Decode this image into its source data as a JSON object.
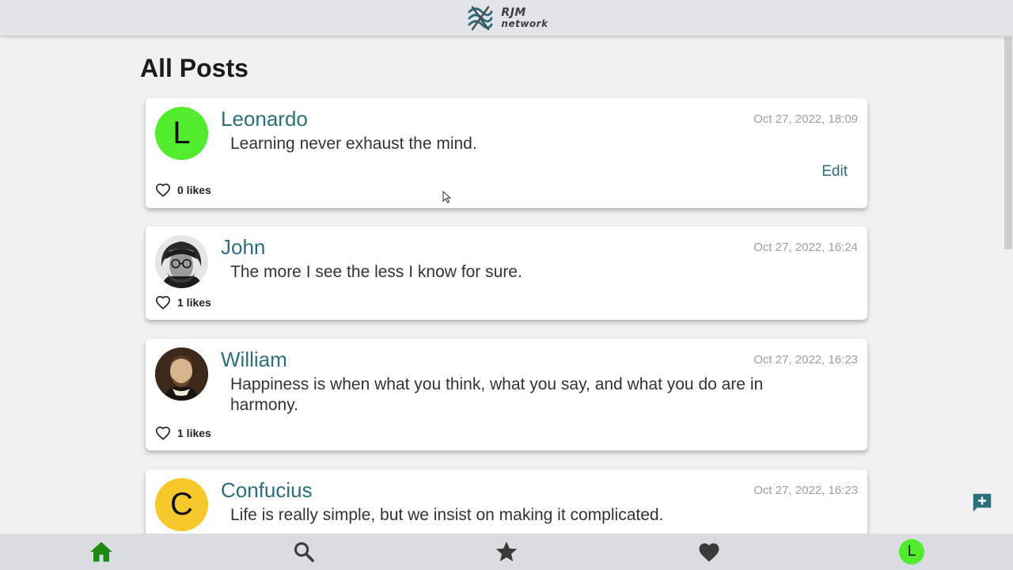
{
  "header": {
    "logo_line1": "RJM",
    "logo_line2": "network"
  },
  "page": {
    "title": "All Posts"
  },
  "posts": [
    {
      "author": "Leonardo",
      "avatar_initial": "L",
      "avatar_color": "#52ec2e",
      "timestamp": "Oct 27, 2022, 18:09",
      "content": "Learning never exhaust the mind.",
      "edit_label": "Edit",
      "likes": "0 likes"
    },
    {
      "author": "John",
      "avatar_icon": "photo-john",
      "timestamp": "Oct 27, 2022, 16:24",
      "content": "The more I see the less I know for sure.",
      "likes": "1 likes"
    },
    {
      "author": "William",
      "avatar_icon": "photo-william",
      "timestamp": "Oct 27, 2022, 16:23",
      "content": "Happiness is when what you think, what you say, and what you do are in harmony.",
      "likes": "1 likes"
    },
    {
      "author": "Confucius",
      "avatar_initial": "C",
      "avatar_color": "#f6c82c",
      "timestamp": "Oct 27, 2022, 16:23",
      "content": "Life is really simple, but we insist on making it complicated.",
      "likes": ""
    }
  ],
  "bottom_nav": {
    "items": [
      "home-icon",
      "search-icon",
      "star-icon",
      "heart-icon",
      "profile-avatar"
    ],
    "profile_initial": "L",
    "active_color": "#1f8a12",
    "icon_color": "#3a3a3a"
  },
  "new_post_icon": "add-comment-icon",
  "colors": {
    "accent": "#2b6f7d",
    "background": "#f1f1f1"
  }
}
